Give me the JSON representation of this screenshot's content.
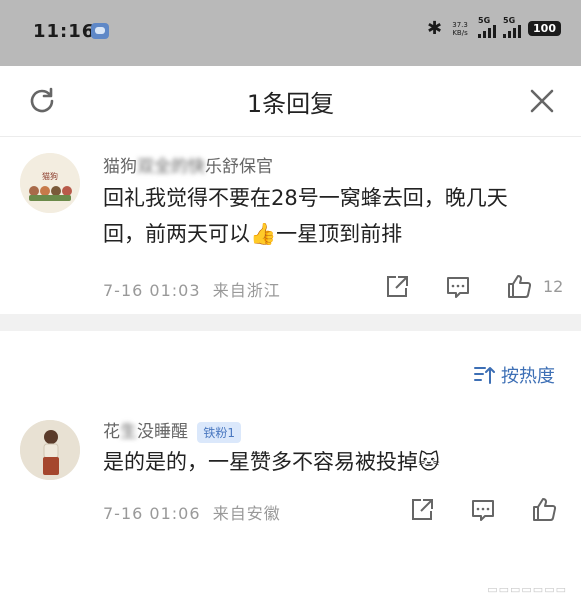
{
  "status_bar": {
    "time": "11:16",
    "speed_value": "37.3",
    "speed_unit": "KB/s",
    "signal_label_1": "5G",
    "signal_label_2": "5G",
    "battery": "100"
  },
  "header": {
    "title": "1条回复"
  },
  "comments": [
    {
      "name_left": "猫狗",
      "name_right": "乐舒保官",
      "text_line1": "回礼我觉得不要在28号一窝蜂去回，晚几天",
      "text_line2": "回，前两天可以👍一星顶到前排",
      "timestamp": "7-16 01:03",
      "location": "来自浙江",
      "likes": "12"
    },
    {
      "name_left": "花",
      "name_right": "没睡醒",
      "badge": "铁粉1",
      "text_line1": "是的是的，一星赞多不容易被投掉🐱",
      "timestamp": "7-16 01:06",
      "location": "来自安徽"
    }
  ],
  "sort": {
    "label": "按热度"
  }
}
